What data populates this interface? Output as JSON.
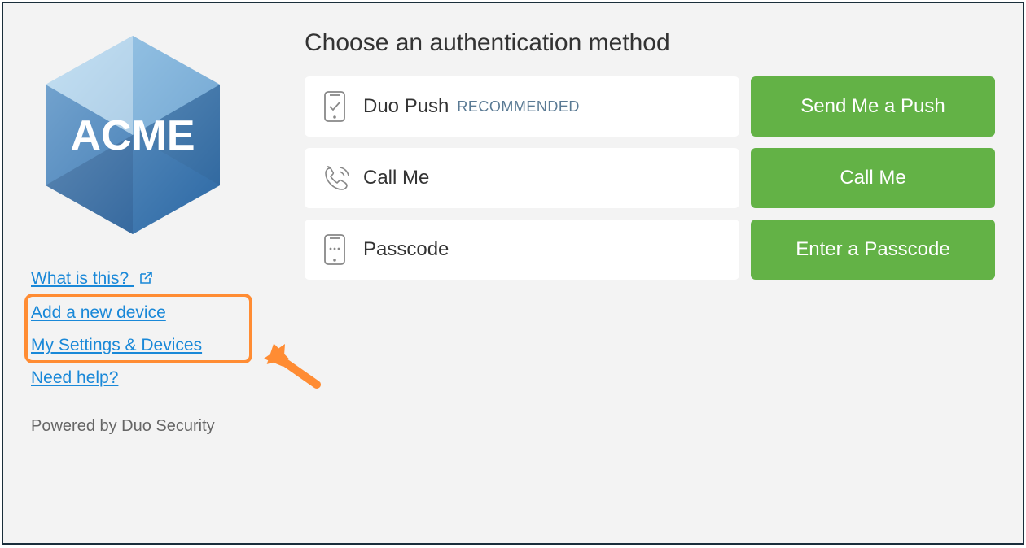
{
  "sidebar": {
    "brand": "ACME",
    "links": {
      "what_is_this": "What is this?",
      "add_device": "Add a new device",
      "my_settings": "My Settings & Devices",
      "need_help": "Need help?"
    },
    "powered_by": "Powered by Duo Security"
  },
  "main": {
    "title": "Choose an authentication method",
    "methods": {
      "push": {
        "label": "Duo Push",
        "recommended": "RECOMMENDED",
        "button": "Send Me a Push"
      },
      "call": {
        "label": "Call Me",
        "button": "Call Me"
      },
      "passcode": {
        "label": "Passcode",
        "button": "Enter a Passcode"
      }
    }
  },
  "colors": {
    "link": "#1988d8",
    "button": "#63b246",
    "highlight": "#ff8c33"
  }
}
